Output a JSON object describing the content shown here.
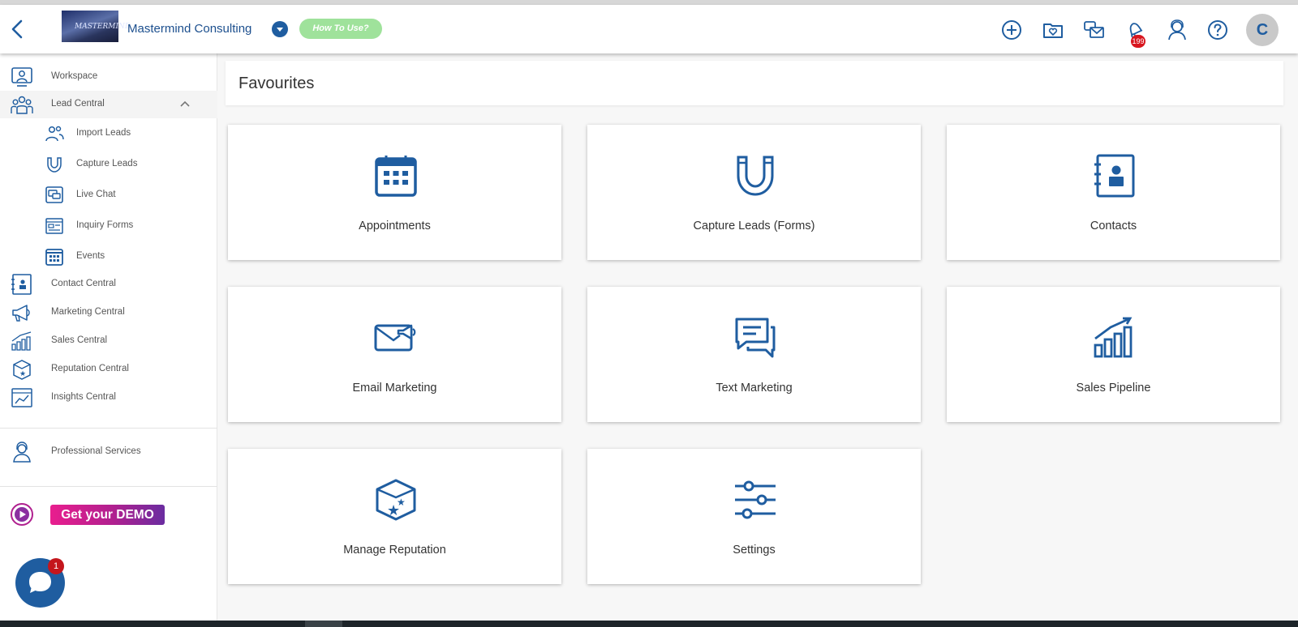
{
  "header": {
    "company_name": "Mastermind Consulting",
    "logo_text": "MASTERMIND",
    "how_to_use": "How To Use?",
    "notification_count": "199",
    "avatar_initial": "C"
  },
  "sidebar": {
    "items": [
      {
        "label": "Workspace"
      },
      {
        "label": "Lead Central"
      },
      {
        "label": "Import Leads"
      },
      {
        "label": "Capture Leads"
      },
      {
        "label": "Live Chat"
      },
      {
        "label": "Inquiry Forms"
      },
      {
        "label": "Events"
      },
      {
        "label": "Contact Central"
      },
      {
        "label": "Marketing Central"
      },
      {
        "label": "Sales Central"
      },
      {
        "label": "Reputation Central"
      },
      {
        "label": "Insights Central"
      },
      {
        "label": "Professional Services"
      }
    ],
    "demo_label": "Get your DEMO"
  },
  "chat_widget": {
    "badge_count": "1"
  },
  "main": {
    "title": "Favourites",
    "cards": [
      {
        "label": "Appointments",
        "icon": "calendar-icon"
      },
      {
        "label": "Capture Leads (Forms)",
        "icon": "magnet-icon"
      },
      {
        "label": "Contacts",
        "icon": "contact-book-icon"
      },
      {
        "label": "Email Marketing",
        "icon": "email-megaphone-icon"
      },
      {
        "label": "Text Marketing",
        "icon": "chat-bubbles-icon"
      },
      {
        "label": "Sales Pipeline",
        "icon": "bar-chart-icon"
      },
      {
        "label": "Manage Reputation",
        "icon": "star-box-icon"
      },
      {
        "label": "Settings",
        "icon": "sliders-icon"
      }
    ]
  },
  "colors": {
    "brand_blue": "#1f5da0",
    "badge_red": "#d8151e",
    "how_to_green": "#9fe29b",
    "demo_pink": "#e91e8e"
  }
}
